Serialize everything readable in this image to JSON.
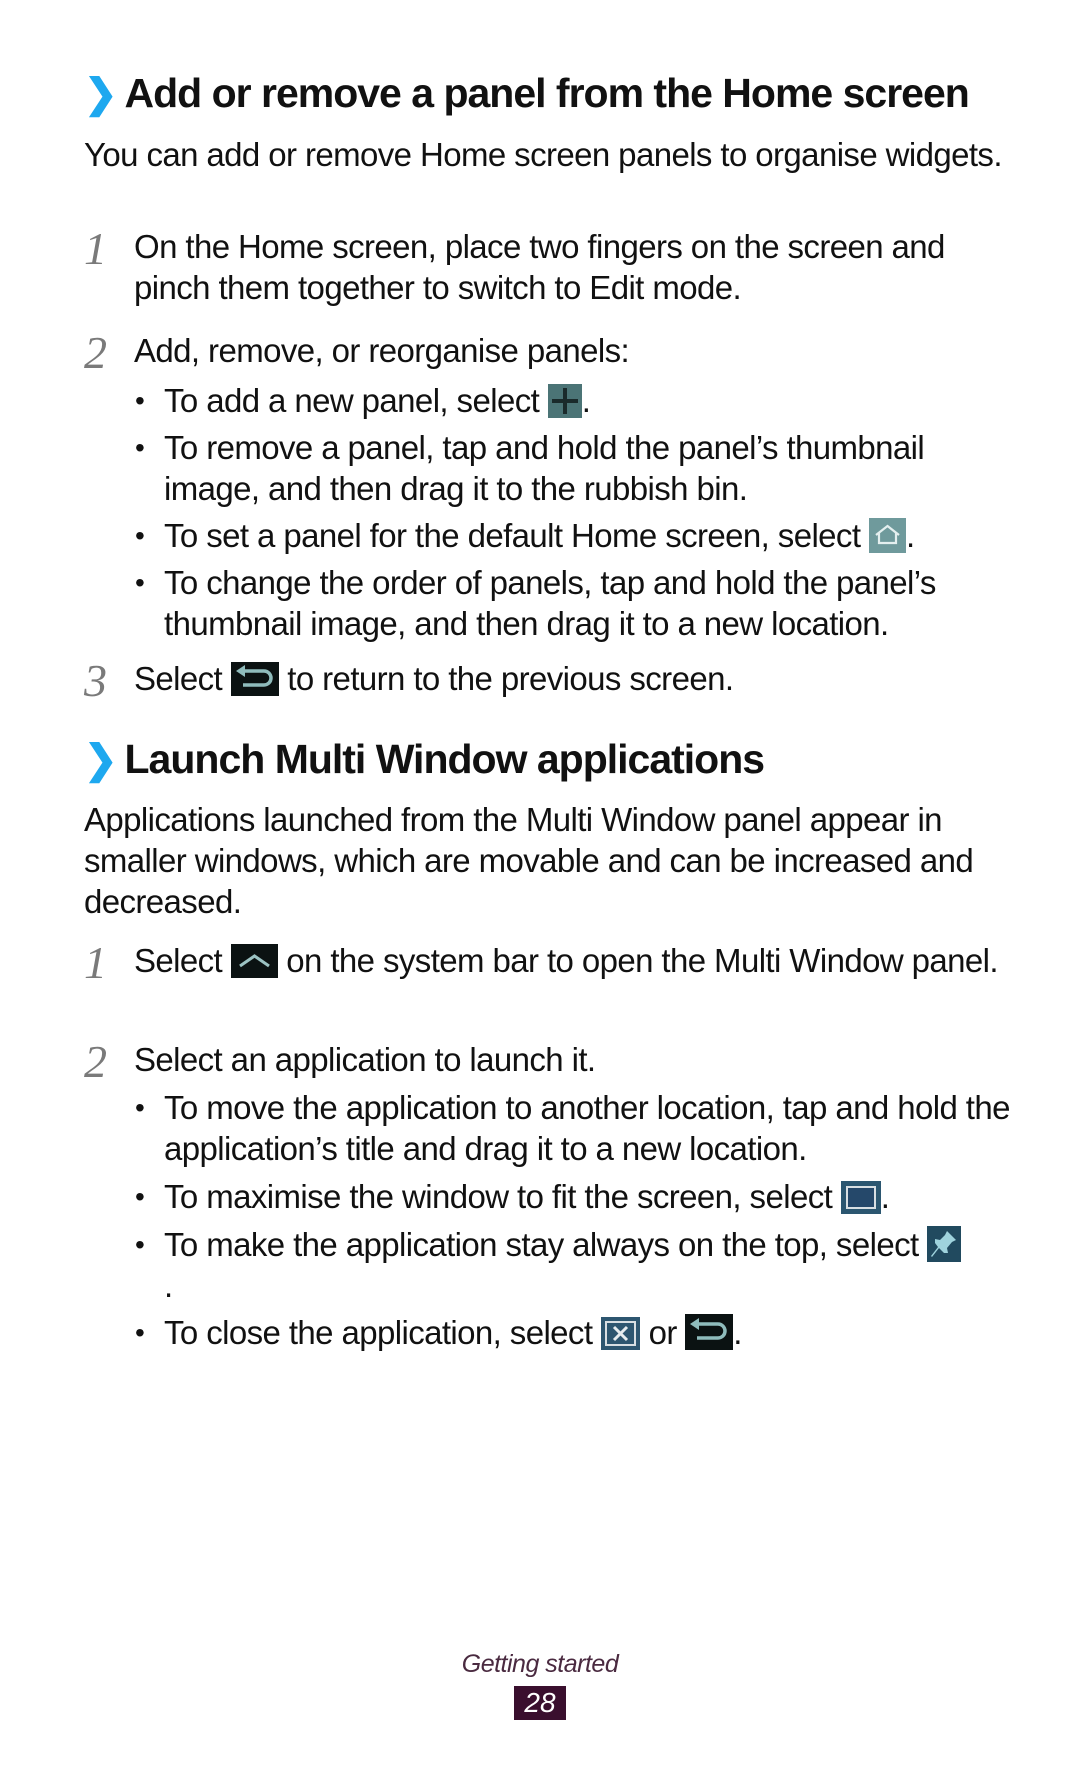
{
  "section1": {
    "title": "Add or remove a panel from the Home screen",
    "intro": "You can add or remove Home screen panels to organise widgets.",
    "steps": [
      {
        "num": "1",
        "text": "On the Home screen, place two fingers on the screen and pinch them together to switch to Edit mode."
      },
      {
        "num": "2",
        "text": "Add, remove, or reorganise panels:"
      },
      {
        "num": "3",
        "text_before": "Select",
        "text_after": "to return to the previous screen.",
        "icon": "back-icon"
      }
    ],
    "bullets": [
      {
        "text_before": "To add a new panel, select",
        "text_after": ".",
        "icon": "add-panel-icon"
      },
      {
        "text": "To remove a panel, tap and hold the panel’s thumbnail image, and then drag it to the rubbish bin."
      },
      {
        "text_before": "To set a panel for the default Home screen, select",
        "text_after": ".",
        "icon": "home-icon"
      },
      {
        "text": "To change the order of panels, tap and hold the panel’s thumbnail image, and then drag it to a new location."
      }
    ]
  },
  "section2": {
    "title": "Launch Multi Window applications",
    "intro": "Applications launched from the Multi Window panel appear in smaller windows, which are movable and can be increased and decreased.",
    "steps": [
      {
        "num": "1",
        "text_before": "Select",
        "text_after": "on the system bar to open the Multi Window panel.",
        "icon": "multi-window-icon"
      },
      {
        "num": "2",
        "text": "Select an application to launch it."
      }
    ],
    "bullets": [
      {
        "text": "To move the application to another location, tap and hold the application’s title and drag it to a new location."
      },
      {
        "text_before": "To maximise the window to fit the screen, select",
        "text_after": ".",
        "icon": "maximise-icon"
      },
      {
        "text_before": "To make the application stay always on the top, select",
        "text_after": ".",
        "icon": "pin-icon"
      },
      {
        "text_before": "To close the application, select",
        "text_mid": "or",
        "text_after": ".",
        "icon": "close-window-icon",
        "icon2": "back-icon"
      }
    ]
  },
  "bullet_char": "•",
  "chevron": "❯",
  "footer": {
    "section_label": "Getting started",
    "page_number": "28"
  },
  "colors": {
    "chevron": "#1ea8ef",
    "footer_text": "#4a2a40",
    "page_badge": "#3a0f2e",
    "step_number": "#7a7a7a"
  }
}
